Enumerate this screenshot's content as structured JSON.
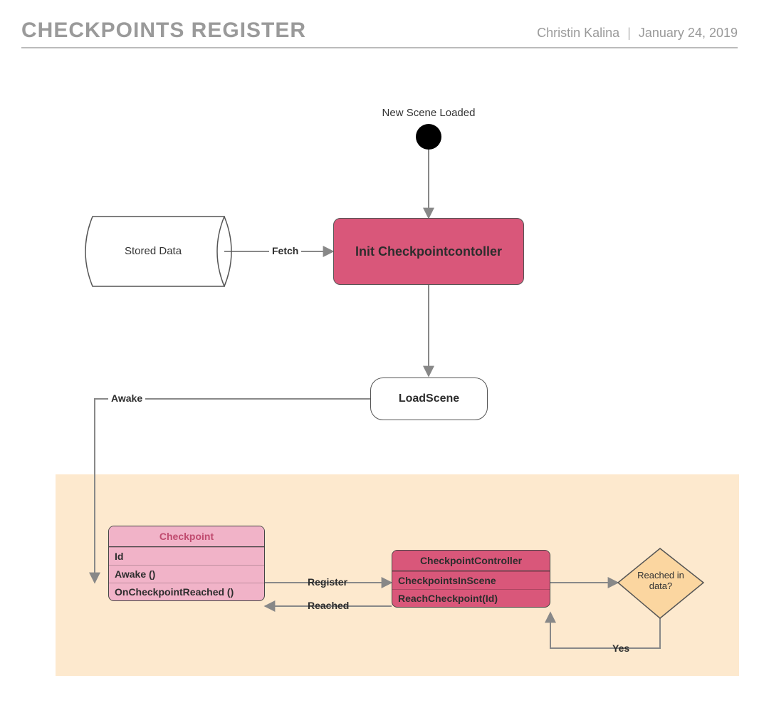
{
  "header": {
    "title": "CHECKPOINTS REGISTER",
    "author": "Christin Kalina",
    "date": "January 24, 2019"
  },
  "nodes": {
    "start_label": "New Scene Loaded",
    "stored_data": "Stored Data",
    "init_controller": "Init Checkpointcontoller",
    "load_scene": "LoadScene",
    "checkpoint": {
      "title": "Checkpoint",
      "rows": [
        "Id",
        "Awake ()",
        "OnCheckpointReached ()"
      ]
    },
    "controller": {
      "title": "CheckpointController",
      "rows": [
        "CheckpointsInScene",
        "ReachCheckpoint(Id)"
      ]
    },
    "decision": "Reached in data?"
  },
  "edges": {
    "fetch": "Fetch",
    "awake": "Awake",
    "register": "Register",
    "reached": "Reached",
    "yes": "Yes"
  }
}
